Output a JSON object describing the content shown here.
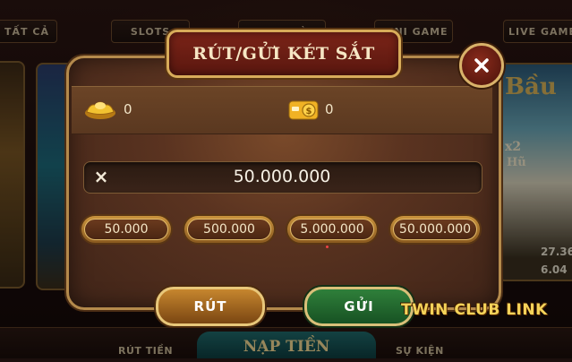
{
  "background": {
    "top_tabs": [
      {
        "label": "TẤT CẢ"
      },
      {
        "label": "SLOTS"
      },
      {
        "label": "GAME BÀI"
      },
      {
        "label": "MINI GAME"
      },
      {
        "label": "LIVE GAME"
      }
    ],
    "card_texts": {
      "right_brand": "Bầu",
      "multiplier": "x2",
      "multiplier_unit": "Hũ",
      "value_1": "27.36",
      "value_2": "6.04"
    },
    "bottom_nav": {
      "rut_tien": "RÚT TIỀN",
      "nap_tien": "NẠP TIỀN",
      "su_kien": "SỰ KIỆN"
    }
  },
  "dialog": {
    "title": "RÚT/GỬI KÉT SẮT",
    "close_icon": "close-icon",
    "balances": {
      "gold": {
        "icon": "gold-ingot-icon",
        "value": "0"
      },
      "coin": {
        "icon": "wallet-coin-icon",
        "value": "0"
      }
    },
    "amount_field": {
      "value": "50.000.000",
      "clear_icon": "×"
    },
    "presets": [
      {
        "label": "50.000"
      },
      {
        "label": "500.000"
      },
      {
        "label": "5.000.000"
      },
      {
        "label": "50.000.000"
      }
    ],
    "actions": {
      "withdraw_label": "RÚT",
      "deposit_label": "GỬI"
    }
  },
  "watermark": "TWIN CLUB LINK",
  "colors": {
    "gold_border": "#d8ac5a",
    "title_plate": "#7b2418",
    "withdraw_button": "#c6862e",
    "deposit_button": "#2f7f3a"
  }
}
